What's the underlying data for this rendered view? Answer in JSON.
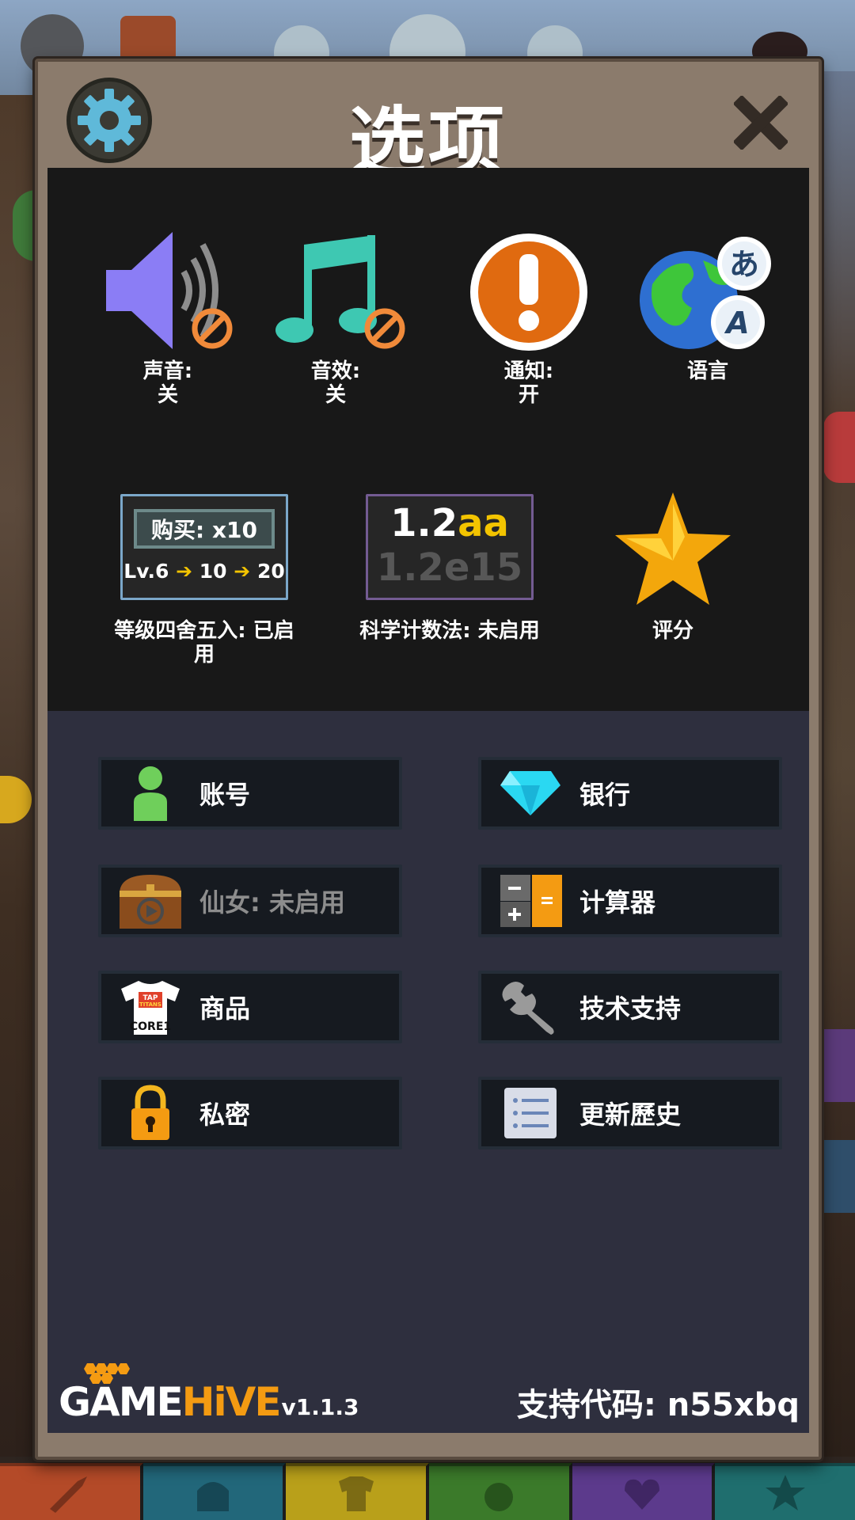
{
  "panel": {
    "title": "选项"
  },
  "options_row1": [
    {
      "label": "声音:",
      "value": "关",
      "icon": "speaker-icon"
    },
    {
      "label": "音效:",
      "value": "关",
      "icon": "music-note-icon"
    },
    {
      "label": "通知:",
      "value": "开",
      "icon": "exclamation-icon"
    },
    {
      "label": "语言",
      "value": "",
      "icon": "globe-language-icon"
    }
  ],
  "rounding": {
    "buy_label": "购买: x10",
    "lv_text": "Lv.6",
    "lv_mid": "10",
    "lv_end": "20",
    "caption_line1": "等级四舍五入: 已启",
    "caption_line2": "用"
  },
  "scientific": {
    "top_num": "1.2",
    "top_suffix": "aa",
    "bottom": "1.2e15",
    "caption": "科学计数法: 未启用"
  },
  "rate": {
    "caption": "评分"
  },
  "menu": {
    "account": "账号",
    "bank": "银行",
    "fairy": "仙女: 未启用",
    "calculator": "计算器",
    "merch": "商品",
    "support": "技术支持",
    "privacy": "私密",
    "history": "更新歷史"
  },
  "merch_shirt": {
    "line1": "TAP",
    "line2": "TITANS",
    "line3": "CORE1"
  },
  "footer": {
    "logo_game": "GAME",
    "logo_hive": "HiVE",
    "version": "v1.1.3",
    "support_code": "支持代码: n55xbq"
  },
  "colors": {
    "panel_frame": "#8b7b6c",
    "top_section": "#181818",
    "menu_section": "#2e2f3e",
    "accent_orange": "#e06a10",
    "gold": "#f3c400"
  }
}
